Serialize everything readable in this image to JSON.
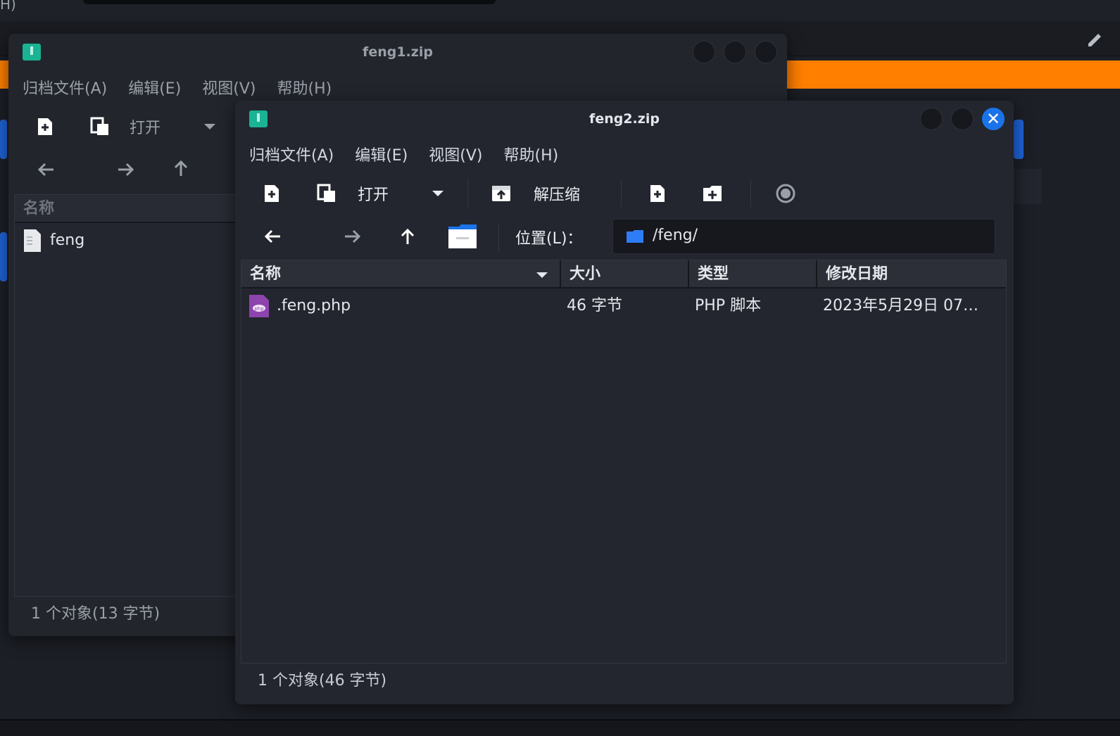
{
  "background": {
    "partial_text": "H)"
  },
  "window1": {
    "title": "feng1.zip",
    "menu": [
      "归档文件(A)",
      "编辑(E)",
      "视图(V)",
      "帮助(H)"
    ],
    "toolbar": {
      "open_label": "打开"
    },
    "column_name": "名称",
    "rows": [
      {
        "name": "feng",
        "icon": "generic-file-icon"
      }
    ],
    "status": "1 个对象(13 字节)"
  },
  "window2": {
    "title": "feng2.zip",
    "menu": [
      "归档文件(A)",
      "编辑(E)",
      "视图(V)",
      "帮助(H)"
    ],
    "toolbar": {
      "open_label": "打开",
      "extract_label": "解压缩"
    },
    "location": {
      "label": "位置(L)：",
      "value": "/feng/"
    },
    "columns": [
      "名称",
      "大小",
      "类型",
      "修改日期"
    ],
    "rows": [
      {
        "name": ".feng.php",
        "size": "46 字节",
        "type": "PHP 脚本",
        "modified": "2023年5月29日 07…",
        "icon": "php-file-icon"
      }
    ],
    "status": "1 个对象(46 字节)"
  },
  "colors": {
    "accent": "#1a73e8",
    "orange": "#ff7f00",
    "app_icon": "#1ab394",
    "php_icon": "#8e44ad"
  }
}
